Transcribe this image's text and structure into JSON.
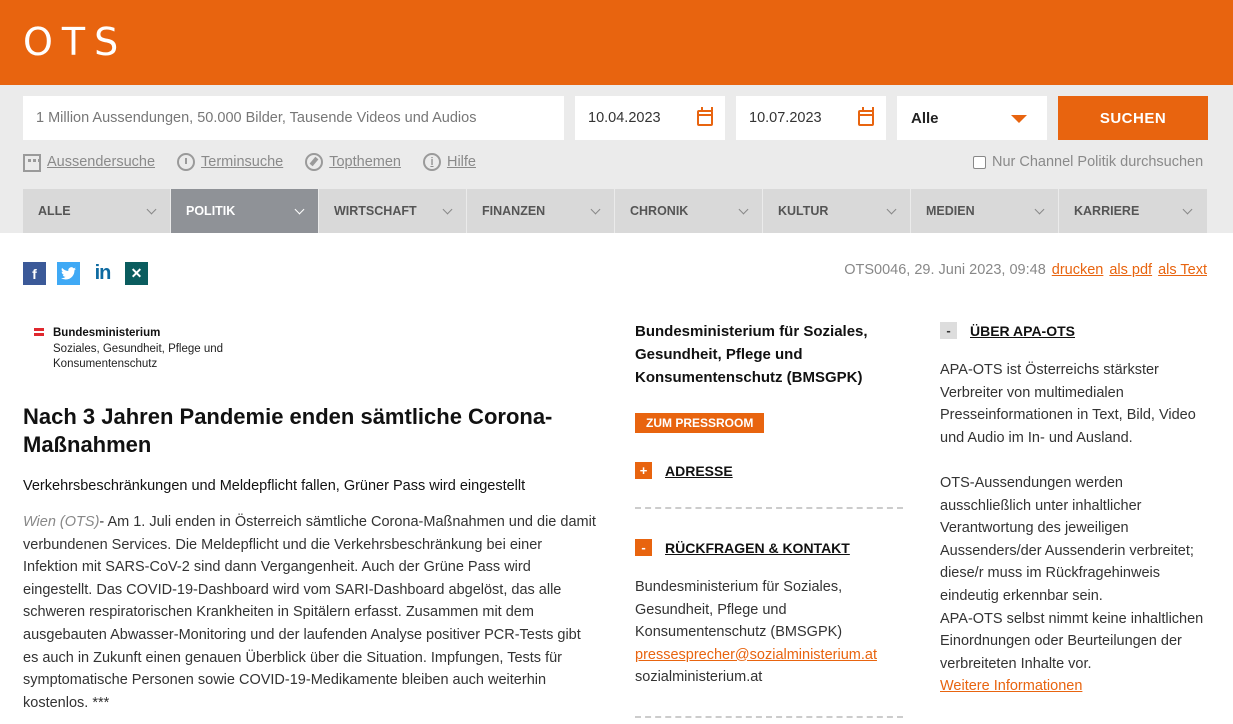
{
  "header": {
    "logo": "OTS"
  },
  "search": {
    "placeholder": "1 Million Aussendungen, 50.000 Bilder, Tausende Videos und Audios",
    "date_from": "10.04.2023",
    "date_to": "10.07.2023",
    "scope": "Alle",
    "button": "SUCHEN",
    "links": [
      "Aussendersuche",
      "Terminsuche",
      "Topthemen",
      "Hilfe"
    ],
    "channel_checkbox": "Nur Channel Politik durchsuchen"
  },
  "categories": [
    "ALLE",
    "POLITIK",
    "WIRTSCHAFT",
    "FINANZEN",
    "CHRONIK",
    "KULTUR",
    "MEDIEN",
    "KARRIERE"
  ],
  "active_category": "POLITIK",
  "meta": {
    "id_date": "OTS0046, 29. Juni 2023, 09:48",
    "print": "drucken",
    "pdf": "als pdf",
    "text": "als Text"
  },
  "ministry_logo": {
    "title": "Bundesministerium",
    "subtitle": "Soziales, Gesundheit, Pflege und Konsumentenschutz"
  },
  "article": {
    "headline": "Nach 3 Jahren Pandemie enden sämtliche Corona-Maßnahmen",
    "subtitle": "Verkehrsbeschränkungen und Meldepflicht fallen, Grüner Pass wird eingestellt",
    "dateline": "Wien (OTS)",
    "body": "- Am 1. Juli enden in Österreich sämtliche Corona-Maßnahmen und die damit verbundenen Services. Die Meldepflicht und die Verkehrsbeschränkung bei einer Infektion mit SARS-CoV-2 sind dann Vergangenheit. Auch der Grüne Pass wird eingestellt. Das COVID-19-Dashboard wird vom SARI-Dashboard abgelöst, das alle schweren respiratorischen Krankheiten in Spitälern erfasst. Zusammen mit dem ausgebauten Abwasser-Monitoring und der laufenden Analyse positiver PCR-Tests gibt es auch in Zukunft einen genauen Überblick über die Situation. Impfungen, Tests für symptomatische Personen sowie COVID-19-Medikamente bleiben auch weiterhin kostenlos. ***"
  },
  "sender": {
    "name": "Bundesministerium für Soziales, Gesundheit, Pflege und Konsumentenschutz (BMSGPK)",
    "pressroom": "ZUM PRESSROOM",
    "address_label": "ADRESSE",
    "contact_label": "RÜCKFRAGEN & KONTAKT",
    "contact_name": "Bundesministerium für Soziales, Gesundheit, Pflege und Konsumentenschutz (BMSGPK)",
    "contact_email": "pressesprecher@sozialministerium.at",
    "contact_web": "sozialministerium.at"
  },
  "about": {
    "heading": "ÜBER APA-OTS",
    "p1": "APA-OTS ist Österreichs stärkster Verbreiter von multimedialen Presseinformationen in Text, Bild, Video und Audio im In- und Ausland.",
    "p2": "OTS-Aussendungen werden ausschließlich unter inhaltlicher Verantwortung des jeweiligen Aussenders/der Aussenderin verbreitet; diese/r muss im Rückfragehinweis eindeutig erkennbar sein.",
    "p3": "APA-OTS selbst nimmt keine inhaltlichen Einordnungen oder Beurteilungen der verbreiteten Inhalte vor.",
    "more": "Weitere Informationen"
  },
  "colors": {
    "accent": "#e8640f",
    "nav_bg": "#d9d9d9",
    "nav_active": "#8f9297"
  },
  "icons": [
    "building-icon",
    "clock-icon",
    "compass-icon",
    "info-icon",
    "calendar-icon",
    "facebook-icon",
    "twitter-icon",
    "linkedin-icon",
    "xing-icon"
  ]
}
